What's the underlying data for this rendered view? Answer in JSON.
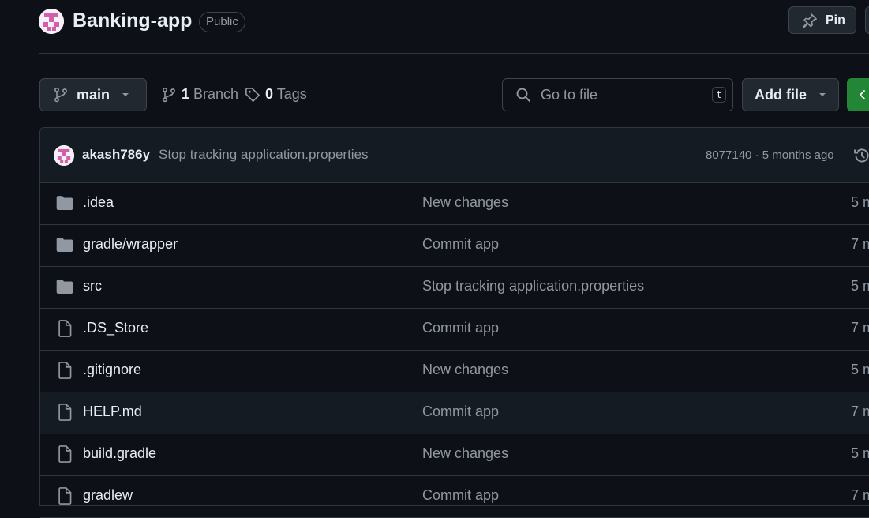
{
  "repo": {
    "name": "Banking-app",
    "visibility": "Public",
    "pin_label": "Pin"
  },
  "toolbar": {
    "branch": "main",
    "branch_count": "1",
    "branch_label": "Branch",
    "tag_count": "0",
    "tag_label": "Tags",
    "search_placeholder": "Go to file",
    "search_shortcut": "t",
    "add_file_label": "Add file"
  },
  "latest_commit": {
    "author": "akash786y",
    "message": "Stop tracking application.properties",
    "hash": "8077140",
    "separator": "·",
    "age": "5 months ago"
  },
  "files": [
    {
      "name": ".idea",
      "type": "folder",
      "message": "New changes",
      "date": "5 m"
    },
    {
      "name": "gradle/wrapper",
      "type": "folder",
      "message": "Commit app",
      "date": "7 m"
    },
    {
      "name": "src",
      "type": "folder",
      "message": "Stop tracking application.properties",
      "date": "5 m"
    },
    {
      "name": ".DS_Store",
      "type": "file",
      "message": "Commit app",
      "date": "7 m"
    },
    {
      "name": ".gitignore",
      "type": "file",
      "message": "New changes",
      "date": "5 m"
    },
    {
      "name": "HELP.md",
      "type": "file",
      "message": "Commit app",
      "date": "7 m"
    },
    {
      "name": "build.gradle",
      "type": "file",
      "message": "New changes",
      "date": "5 m"
    },
    {
      "name": "gradlew",
      "type": "file",
      "message": "Commit app",
      "date": "7 m"
    }
  ],
  "colors": {
    "background": "#0d1117",
    "accent_green": "#238636",
    "avatar_pink": "#d25fae"
  }
}
